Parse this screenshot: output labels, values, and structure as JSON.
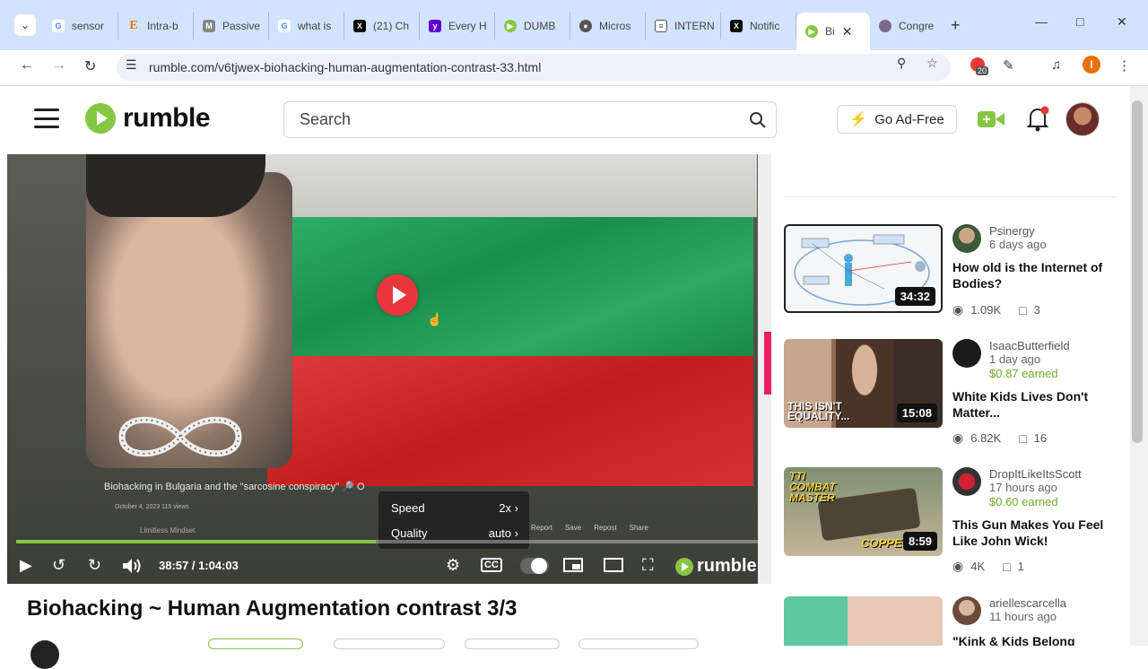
{
  "browser": {
    "tabs": [
      {
        "label": "sensor",
        "icon": "google-icon",
        "color": "#4285f4"
      },
      {
        "label": "Intra-b",
        "icon": "e-icon",
        "color": "#e8710a"
      },
      {
        "label": "Passive",
        "icon": "mb-icon",
        "color": "#888888"
      },
      {
        "label": "what is",
        "icon": "google-icon",
        "color": "#4285f4"
      },
      {
        "label": "(21) Ch",
        "icon": "x-icon",
        "color": "#000000"
      },
      {
        "label": "Every H",
        "icon": "yahoo-icon",
        "color": "#6001d2"
      },
      {
        "label": "DUMB",
        "icon": "rumble-icon",
        "color": "#85c742"
      },
      {
        "label": "Micros",
        "icon": "globe-icon",
        "color": "#555555"
      },
      {
        "label": "INTERN",
        "icon": "doc-icon",
        "color": "#555555"
      },
      {
        "label": "Notific",
        "icon": "x-icon",
        "color": "#000000"
      },
      {
        "label": "Bi",
        "icon": "rumble-icon",
        "color": "#85c742",
        "active": true
      },
      {
        "label": "Congre",
        "icon": "avatar-icon",
        "color": "#7a6a8a"
      }
    ],
    "url": "rumble.com/v6tjwex-biohacking-human-augmentation-contrast-33.html",
    "extension_badge": "20",
    "profile_initial": "I"
  },
  "header": {
    "logo_text": "rumble",
    "search_placeholder": "Search",
    "go_ad_free": "Go Ad-Free"
  },
  "player": {
    "inner_caption": "Biohacking in Bulgaria and the \"sarcosine conspiracy\" 🔎 O",
    "inner_meta": "October 4, 2023   115 views",
    "inner_channel": "Limitless Mindset",
    "inner_actions": [
      "Report",
      "Save",
      "Repost",
      "Share"
    ],
    "settings_menu": [
      {
        "label": "Speed",
        "value": "2x"
      },
      {
        "label": "Quality",
        "value": "auto"
      }
    ],
    "time": "38:57 / 1:04:03",
    "progress_fraction": 0.483,
    "watermark": "rumble"
  },
  "video": {
    "title": "Biohacking ~ Human Augmentation contrast 3/3"
  },
  "recommendations": [
    {
      "channel": "Psinergy",
      "age": "6 days ago",
      "earned": "",
      "title": "How old is the Internet of Bodies?",
      "views": "1.09K",
      "comments": "3",
      "duration": "34:32"
    },
    {
      "channel": "IsaacButterfield",
      "age": "1 day ago",
      "earned": "$0.87 earned",
      "title": "White Kids Lives Don't Matter...",
      "views": "6.82K",
      "comments": "16",
      "duration": "15:08",
      "thumb_text": "THIS ISN'T EQUALITY..."
    },
    {
      "channel": "DropItLikeItsScott",
      "age": "17 hours ago",
      "earned": "$0.60 earned",
      "title": "This Gun Makes You Feel Like John Wick!",
      "views": "4K",
      "comments": "1",
      "duration": "8:59",
      "thumb_text_top": "TTI COMBAT MASTER",
      "thumb_text_bottom": "COPPE"
    },
    {
      "channel": "ariellescarcella",
      "age": "11 hours ago",
      "earned": "",
      "title": "\"Kink & Kids Belong"
    }
  ]
}
